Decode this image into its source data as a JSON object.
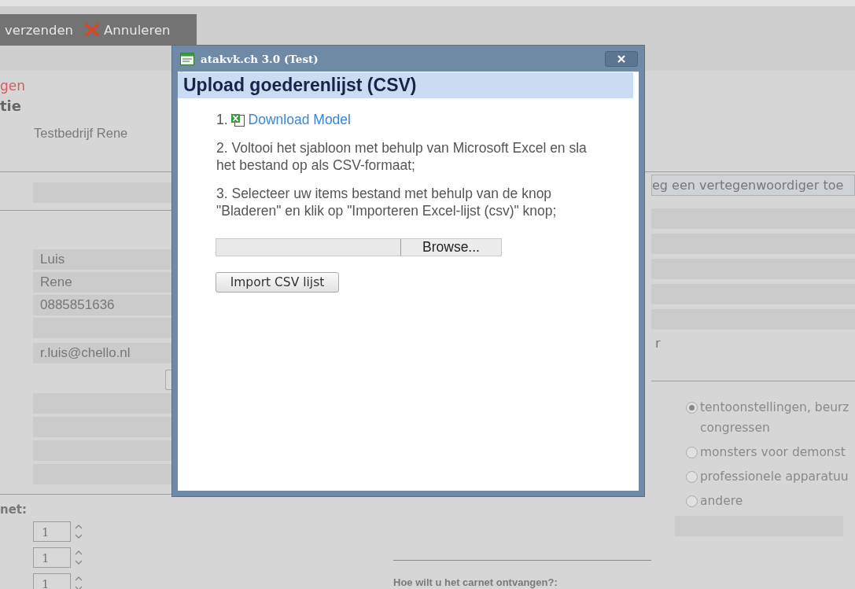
{
  "toolbar": {
    "buttons": [
      {
        "kind": "send",
        "label": "verzenden"
      },
      {
        "kind": "cancel",
        "label": "Annuleren"
      }
    ]
  },
  "left": {
    "link": "gen",
    "heading": "tie",
    "company": "Testbedrijf Rene",
    "top_field": {
      "kind": "text"
    },
    "contact_fields": [
      {
        "kind": "text",
        "value": "Luis"
      },
      {
        "kind": "text",
        "value": "Rene"
      },
      {
        "kind": "text",
        "value": "0885851636"
      },
      {
        "kind": "text"
      },
      {
        "kind": "text",
        "value": "r.luis@chello.nl"
      }
    ],
    "address_fields": [
      {
        "kind": "text"
      },
      {
        "kind": "text"
      },
      {
        "kind": "text"
      },
      {
        "kind": "text"
      }
    ],
    "count_label": "net:",
    "spinners": [
      {
        "value": "1"
      },
      {
        "value": "1"
      },
      {
        "value": "1"
      }
    ]
  },
  "right": {
    "add_button": "eg een vertegenwoordiger toe",
    "fields": [
      {
        "kind": "text"
      },
      {
        "kind": "text"
      },
      {
        "kind": "text"
      },
      {
        "kind": "text"
      },
      {
        "kind": "text"
      }
    ],
    "label": "r",
    "radios": [
      {
        "label_lines": [
          "tentoonstellingen, beurz",
          "congressen"
        ],
        "selected": true
      },
      {
        "label_lines": [
          "monsters voor demonst"
        ],
        "selected": false
      },
      {
        "label_lines": [
          "professionele apparatuu"
        ],
        "selected": false
      },
      {
        "label_lines": [
          "andere"
        ],
        "selected": false
      }
    ],
    "other_field": {
      "kind": "text"
    }
  },
  "bottom": {
    "heading": "Hoe wilt u het carnet ontvangen?:"
  },
  "dialog": {
    "title": "atakvk.ch 3.0 (Test)",
    "heading": "Upload goederenlijst (CSV)",
    "steps": [
      {
        "kind": "link",
        "number": "1.",
        "link": "Download Model"
      },
      {
        "kind": "text",
        "text": "2. Voltooi het sjabloon met behulp van Microsoft Excel en sla het bestand op als CSV-formaat;"
      },
      {
        "kind": "text",
        "text": "3. Selecteer uw items bestand met behulp van de knop \"Bladeren\" en klik op \"Importeren Excel-lijst (csv)\" knop;"
      }
    ],
    "file_input": {
      "button": "Browse..."
    },
    "import_button": "Import CSV lijst"
  }
}
